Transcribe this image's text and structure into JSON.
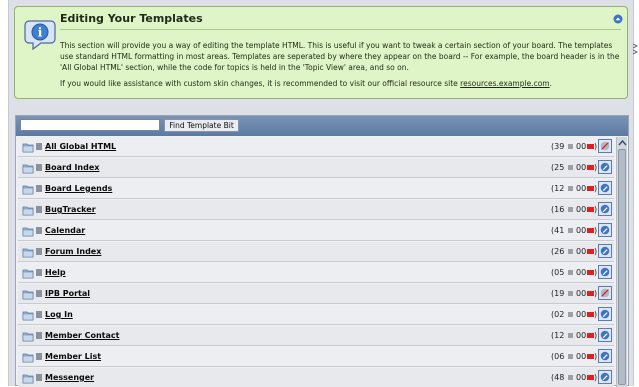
{
  "info": {
    "title": "Editing Your Templates",
    "paragraph1": "This section will provide you a way of editing the template HTML. This is useful if you want to tweak a certain section of your board. The templates use standard HTML formatting in most areas. Templates are seperated by where they appear on the board -- For example, the board header is in the 'All Global HTML' section, while the code for topics is held in the 'Topic View' area, and so on.",
    "paragraph2_prefix": "If you would like assistance with custom skin changes, it is recommended to visit our official resource site ",
    "paragraph2_link": "resources.example.com",
    "paragraph2_suffix": "."
  },
  "toolbar": {
    "search_value": "",
    "find_label": "Find Template Bit"
  },
  "rows": [
    {
      "label": "All Global HTML",
      "count": "(39",
      "oo": "00",
      "paren": ")",
      "action": "revert-disabled"
    },
    {
      "label": "Board Index",
      "count": "(25",
      "oo": "00",
      "paren": ")",
      "action": "edit"
    },
    {
      "label": "Board Legends",
      "count": "(12",
      "oo": "00",
      "paren": ")",
      "action": "edit"
    },
    {
      "label": "BugTracker",
      "count": "(16",
      "oo": "00",
      "paren": ")",
      "action": "edit"
    },
    {
      "label": "Calendar",
      "count": "(41",
      "oo": "00",
      "paren": ")",
      "action": "edit"
    },
    {
      "label": "Forum Index",
      "count": "(26",
      "oo": "00",
      "paren": ")",
      "action": "edit"
    },
    {
      "label": "Help",
      "count": "(05",
      "oo": "00",
      "paren": ")",
      "action": "edit"
    },
    {
      "label": "IPB Portal",
      "count": "(19",
      "oo": "00",
      "paren": ")",
      "action": "revert-disabled"
    },
    {
      "label": "Log In",
      "count": "(02",
      "oo": "00",
      "paren": ")",
      "action": "edit"
    },
    {
      "label": "Member Contact",
      "count": "(12",
      "oo": "00",
      "paren": ")",
      "action": "edit"
    },
    {
      "label": "Member List",
      "count": "(06",
      "oo": "00",
      "paren": ")",
      "action": "edit"
    },
    {
      "label": "Messenger",
      "count": "(48",
      "oo": "00",
      "paren": ")",
      "action": "edit"
    }
  ],
  "colors": {
    "info_bg": "#dff4c7",
    "panel_header": "#5b7aa3",
    "indicator_red": "#e02020"
  }
}
